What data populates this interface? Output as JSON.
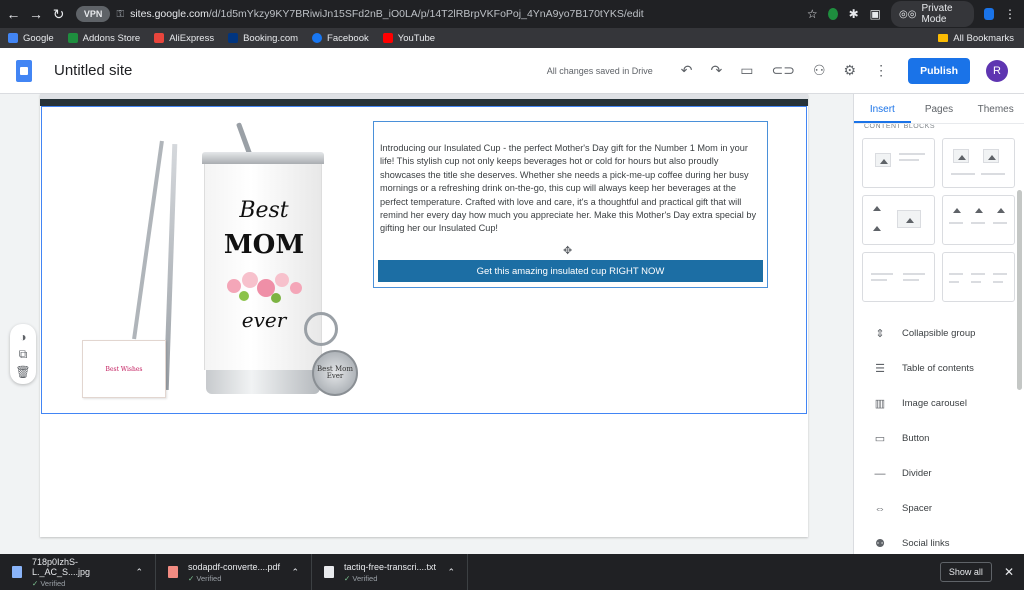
{
  "browser": {
    "vpn_label": "VPN",
    "url_host": "sites.google.com",
    "url_path": "/d/1d5mYkzy9KY7BRiwiJn15SFd2nB_iO0LA/p/14T2lRBrpVKFoPoj_4YnA9yo7B170tYKS/edit",
    "private_mode_label": "Private Mode"
  },
  "bookmarks": {
    "items": [
      {
        "label": "Google",
        "color": "#4285f4"
      },
      {
        "label": "Addons Store",
        "color": "#1e8e3e"
      },
      {
        "label": "AliExpress",
        "color": "#e8453c"
      },
      {
        "label": "Booking.com",
        "color": "#003580"
      },
      {
        "label": "Facebook",
        "color": "#1877f2"
      },
      {
        "label": "YouTube",
        "color": "#ff0000"
      }
    ],
    "all_label": "All Bookmarks"
  },
  "sites": {
    "title": "Untitled site",
    "saved_status": "All changes saved in Drive",
    "publish_label": "Publish",
    "avatar_initial": "R"
  },
  "content": {
    "description": "Introducing our Insulated Cup - the perfect Mother's Day gift for the Number 1 Mom in your life! This stylish cup not only keeps beverages hot or cold for hours but also proudly showcases the title she deserves. Whether she needs a pick-me-up coffee during her busy mornings or a refreshing drink on-the-go, this cup will always keep her beverages at the perfect temperature. Crafted with love and care, it's a thoughtful and practical gift that will remind her every day how much you appreciate her. Make this Mother's Day extra special by gifting her our Insulated Cup!",
    "cta_label": "Get this amazing insulated cup RIGHT NOW",
    "product_image": {
      "mug_line1": "Best",
      "mug_line2": "MOM",
      "mug_line3": "ever",
      "card_text": "Best Wishes",
      "keychain_text": "Best Mom Ever"
    }
  },
  "panel": {
    "tabs": [
      {
        "label": "Insert",
        "active": true
      },
      {
        "label": "Pages",
        "active": false
      },
      {
        "label": "Themes",
        "active": false
      }
    ],
    "blocks_label": "CONTENT BLOCKS",
    "insert_items": [
      {
        "label": "Collapsible group",
        "icon": "collapsible-icon"
      },
      {
        "label": "Table of contents",
        "icon": "toc-icon"
      },
      {
        "label": "Image carousel",
        "icon": "carousel-icon"
      },
      {
        "label": "Button",
        "icon": "button-icon"
      },
      {
        "label": "Divider",
        "icon": "divider-icon"
      },
      {
        "label": "Spacer",
        "icon": "spacer-icon"
      },
      {
        "label": "Social links",
        "icon": "social-links-icon"
      }
    ]
  },
  "downloads": {
    "items": [
      {
        "name": "718p0IzhS-L._AC_S....jpg",
        "status": "Verified",
        "type": "img"
      },
      {
        "name": "sodapdf-converte....pdf",
        "status": "Verified",
        "type": "pdf"
      },
      {
        "name": "tactiq-free-transcri....txt",
        "status": "Verified",
        "type": "txt"
      }
    ],
    "show_all_label": "Show all"
  }
}
